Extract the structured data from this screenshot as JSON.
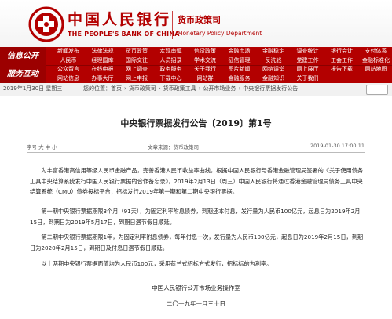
{
  "header": {
    "bank_name_cn": "中国人民银行",
    "bank_name_en": "THE PEOPLE'S BANK OF CHINA",
    "dept_cn": "货币政策司",
    "dept_en": "Monetary Policy Department",
    "brand_color": "#b30000"
  },
  "nav": {
    "rows": [
      {
        "label": "信息公开",
        "top": [
          "新闻发布",
          "法律法规",
          "货币政策",
          "宏观审慎",
          "信贷政策",
          "金融市场",
          "金融稳定",
          "调查统计",
          "银行会计",
          "支付体系"
        ],
        "bottom": [
          "人民币",
          "经理国库",
          "国际交往",
          "人员招录",
          "学术交流",
          "征信管理",
          "反洗钱",
          "党建工作",
          "工会工作",
          "金融标准化"
        ]
      },
      {
        "label": "服务互动",
        "top": [
          "公众留言",
          "在线申报",
          "网上调查",
          "政务服务",
          "关于我行",
          "图片新闻",
          "网络课堂",
          "网上展厅",
          "报告下载",
          "网站地图"
        ],
        "bottom": [
          "网站信息",
          "办事大厅",
          "网上申报",
          "下载中心",
          "网站群",
          "金融服务",
          "金融知识",
          "关于我们",
          "",
          ""
        ]
      }
    ]
  },
  "breadcrumb": {
    "date": "2019年1月30日 星期三",
    "path": [
      "您的位置：首页",
      "货币政策司",
      "货币政策工具",
      "公开市场业务",
      "中央银行票据发行公告"
    ],
    "sep": "›"
  },
  "article": {
    "title": "中央银行票据发行公告〔2019〕第1号",
    "meta_size": "字号  大  中  小",
    "meta_source": "文章来源：货币政策司",
    "meta_time": "2019-01-30  17:00:11",
    "paragraphs": [
      "为丰富香港高信用等级人民币金融产品，完善香港人民币收益率曲线，根据中国人民银行与香港金融管理局签署的《关于使用债务工具中央结算系统发行中国人民银行票据的合作备忘录》，2019年2月13日（周三）中国人民银行将通过香港金融管理局债务工具中央结算系统（CMU）债券投标平台，招标发行2019年第一期和第二期中央银行票据。",
      "第一期中央银行票据期限3个月（91天），为固定利率附息债券，到期还本付息，发行量为人民币100亿元，起息日为2019年2月15日，到期日为2019年5月17日，到期日遇节假日顺延。",
      "第二期中央银行票据期限1年，为固定利率附息债券，每年付息一次，发行量为人民币100亿元，起息日为2019年2月15日，到期日为2020年2月15日，到期日及付息日遇节假日顺延。",
      "以上两期中央银行票据面值均为人民币100元，采用荷兰式招标方式发行，招标标的为利率。"
    ],
    "signature_org": "中国人民银行公开市场业务操作室",
    "signature_date": "二〇一九年一月三十日"
  }
}
